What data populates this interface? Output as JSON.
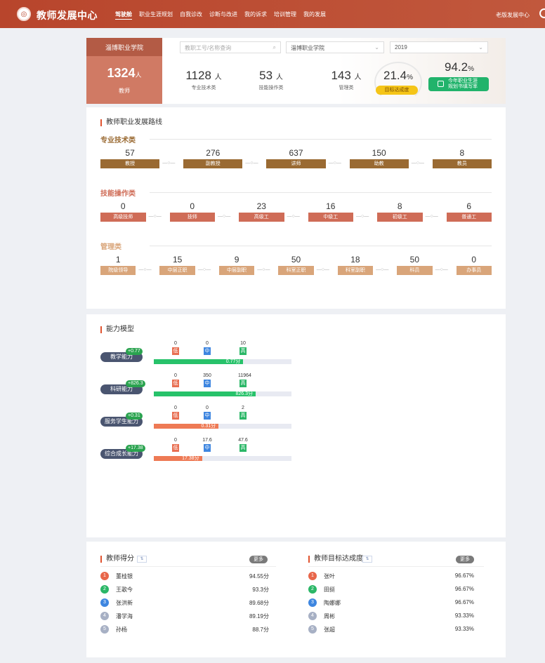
{
  "header": {
    "app_title": "教师发展中心",
    "nav": [
      "驾驶舱",
      "职业生涯规划",
      "自我诊改",
      "诊断与改进",
      "我的诉求",
      "培训管理",
      "我的发展"
    ],
    "old_version": "老版发展中心"
  },
  "summary": {
    "school_tab": "淄博职业学院",
    "search_placeholder": "教职工号/名称查询",
    "college_select": "淄博职业学院",
    "year_select": "2019",
    "teacher_total": "1324",
    "teacher_unit": "人",
    "teacher_label": "教师",
    "stats": [
      {
        "value": "1128",
        "unit": "人",
        "label": "专业技术类"
      },
      {
        "value": "53",
        "unit": "人",
        "label": "技能操作类"
      },
      {
        "value": "143",
        "unit": "人",
        "label": "管理类"
      }
    ],
    "rate": {
      "value": "21.4",
      "unit": "%",
      "label": "目标达成度"
    },
    "plan_rate": {
      "value": "94.2",
      "unit": "%",
      "label_line1": "今年职业生涯",
      "label_line2": "规划书填写率"
    }
  },
  "career": {
    "title": "教师职业发展路线",
    "categories": [
      {
        "name": "专业技术类",
        "color": "#9a6a32",
        "nodes": [
          {
            "count": "57",
            "label": "教授"
          },
          {
            "count": "276",
            "label": "副教授"
          },
          {
            "count": "637",
            "label": "讲师"
          },
          {
            "count": "150",
            "label": "助教"
          },
          {
            "count": "8",
            "label": "教员"
          }
        ]
      },
      {
        "name": "技能操作类",
        "color": "#cf6c57",
        "nodes": [
          {
            "count": "0",
            "label": "高级技师"
          },
          {
            "count": "0",
            "label": "技师"
          },
          {
            "count": "23",
            "label": "高级工"
          },
          {
            "count": "16",
            "label": "中级工"
          },
          {
            "count": "8",
            "label": "初级工"
          },
          {
            "count": "6",
            "label": "普通工"
          }
        ]
      },
      {
        "name": "管理类",
        "color": "#d9a57a",
        "nodes": [
          {
            "count": "1",
            "label": "院级领导"
          },
          {
            "count": "15",
            "label": "中层正职"
          },
          {
            "count": "9",
            "label": "中层副职"
          },
          {
            "count": "50",
            "label": "科室正职"
          },
          {
            "count": "18",
            "label": "科室副职"
          },
          {
            "count": "50",
            "label": "科员"
          },
          {
            "count": "0",
            "label": "办事员"
          }
        ]
      }
    ],
    "connector": "—○—"
  },
  "ability": {
    "title": "能力模型",
    "level_labels": [
      "低",
      "中",
      "高"
    ],
    "level_colors": [
      "#e86f52",
      "#3e86e0",
      "#2bb767"
    ],
    "rows": [
      {
        "name": "教学能力",
        "delta": "+0.77",
        "levels": [
          "0",
          "0",
          "10"
        ],
        "score": "0.77分",
        "fill_pct": 65,
        "fill_color": "#27c26a"
      },
      {
        "name": "科研能力",
        "delta": "+826.3",
        "levels": [
          "0",
          "350",
          "11964"
        ],
        "score": "826.3分",
        "fill_pct": 74,
        "fill_color": "#27c26a"
      },
      {
        "name": "服务学生能力",
        "delta": "+0.31",
        "levels": [
          "0",
          "0",
          "2"
        ],
        "score": "0.31分",
        "fill_pct": 47,
        "fill_color": "#ee7a55"
      },
      {
        "name": "综合成长能力",
        "delta": "+17.38",
        "levels": [
          "0",
          "17.6",
          "47.6"
        ],
        "score": "17.38分",
        "fill_pct": 35,
        "fill_color": "#ee7a55"
      }
    ]
  },
  "rankings": {
    "more": "更多",
    "filter": "⇅",
    "rank_colors": [
      "#e8664a",
      "#2bb767",
      "#3e86e0",
      "#a7b0c4",
      "#a7b0c4"
    ],
    "left": {
      "title": "教师得分",
      "items": [
        {
          "rank": "1",
          "name": "董桂银",
          "value": "94.55分"
        },
        {
          "rank": "2",
          "name": "王歌今",
          "value": "93.3分"
        },
        {
          "rank": "3",
          "name": "张洪新",
          "value": "89.68分"
        },
        {
          "rank": "4",
          "name": "潘学海",
          "value": "89.19分"
        },
        {
          "rank": "5",
          "name": "孙杨",
          "value": "88.7分"
        }
      ]
    },
    "right": {
      "title": "教师目标达成度",
      "items": [
        {
          "rank": "1",
          "name": "张叶",
          "value": "96.67%"
        },
        {
          "rank": "2",
          "name": "田挺",
          "value": "96.67%"
        },
        {
          "rank": "3",
          "name": "陶娜娜",
          "value": "96.67%"
        },
        {
          "rank": "4",
          "name": "周彬",
          "value": "93.33%"
        },
        {
          "rank": "5",
          "name": "张超",
          "value": "93.33%"
        }
      ]
    }
  }
}
